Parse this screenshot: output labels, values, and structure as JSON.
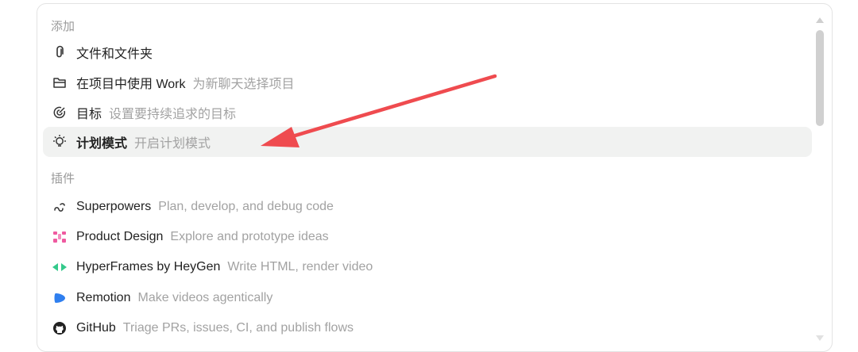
{
  "sections": {
    "add_title": "添加",
    "plugins_title": "插件"
  },
  "add_items": [
    {
      "label": "文件和文件夹",
      "desc": "",
      "icon": "paperclip-icon"
    },
    {
      "label": "在项目中使用 Work",
      "desc": "为新聊天选择项目",
      "icon": "folder-icon"
    },
    {
      "label": "目标",
      "desc": "设置要持续追求的目标",
      "icon": "target-icon"
    },
    {
      "label": "计划模式",
      "desc": "开启计划模式",
      "icon": "lightbulb-icon",
      "active": true
    }
  ],
  "plugin_items": [
    {
      "label": "Superpowers",
      "desc": "Plan, develop, and debug code",
      "icon": "link-icon"
    },
    {
      "label": "Product Design",
      "desc": "Explore and prototype ideas",
      "icon": "product-design-icon"
    },
    {
      "label": "HyperFrames by HeyGen",
      "desc": "Write HTML, render video",
      "icon": "hyperframes-icon"
    },
    {
      "label": "Remotion",
      "desc": "Make videos agentically",
      "icon": "remotion-icon"
    },
    {
      "label": "GitHub",
      "desc": "Triage PRs, issues, CI, and publish flows",
      "icon": "github-icon"
    }
  ],
  "colors": {
    "accent_arrow": "#ef4b4f",
    "active_row": "#f1f2f1",
    "plugin_pink": "#ef5aa0",
    "plugin_green": "#34c98b",
    "plugin_blue": "#2f7fef"
  }
}
